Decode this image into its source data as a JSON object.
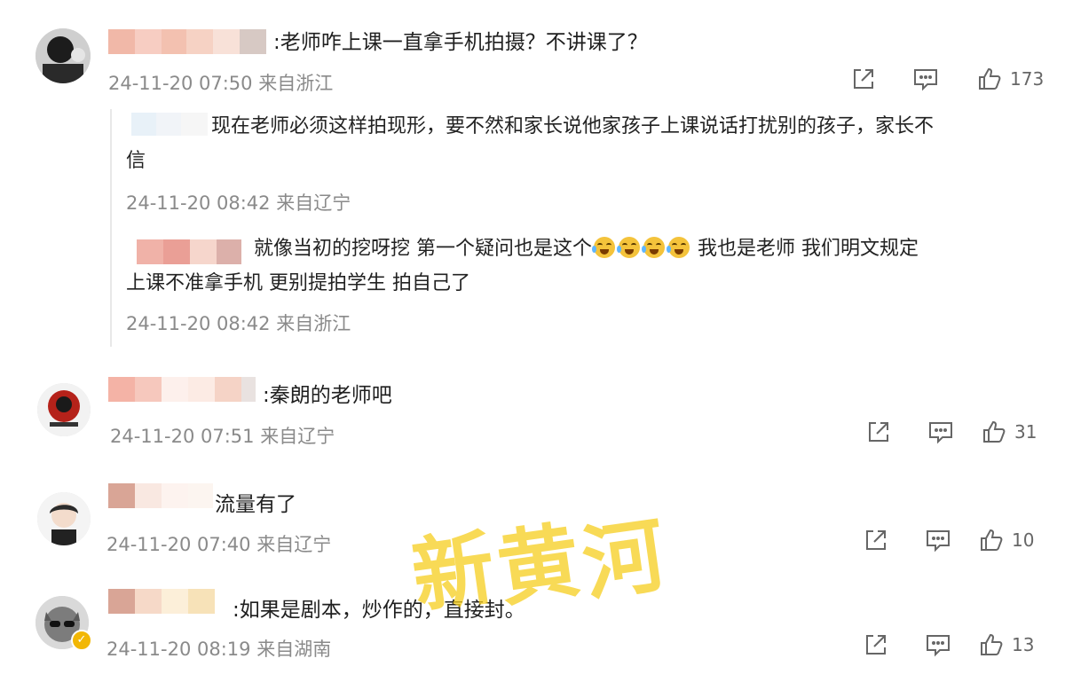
{
  "comments": [
    {
      "text": ":老师咋上课一直拿手机拍摄？不讲课了？",
      "time": "24-11-20 07:50 来自浙江",
      "likes": "173",
      "replies": [
        {
          "text_line1": "现在老师必须这样拍现形，要不然和家长说他家孩子上课说话打扰别的孩子，家长不",
          "text_line2": "信",
          "time": "24-11-20 08:42 来自辽宁"
        },
        {
          "text_a": "就像当初的挖呀挖 第一个疑问也是这个",
          "text_b": " 我也是老师 我们明文规定",
          "text_line2": "上课不准拿手机 更别提拍学生 拍自己了",
          "time": "24-11-20 08:42 来自浙江"
        }
      ]
    },
    {
      "text": ":秦朗的老师吧",
      "time": "24-11-20 07:51 来自辽宁",
      "likes": "31"
    },
    {
      "text": "流量有了",
      "time": "24-11-20 07:40 来自辽宁",
      "likes": "10"
    },
    {
      "text": ":如果是剧本，炒作的，直接封。",
      "time": "24-11-20 08:19 来自湖南",
      "likes": "13"
    }
  ],
  "watermark": [
    "新",
    "黄",
    "河"
  ],
  "icons": {
    "share": "share-icon",
    "comment": "comment-icon",
    "like": "thumbs-up-icon",
    "emoji": "laugh-cry-emoji",
    "verified": "verified-badge-icon"
  },
  "colors": {
    "watermark": "#f5cd1e",
    "meta_text": "#8a8a8a",
    "verified_badge": "#f2b705"
  }
}
